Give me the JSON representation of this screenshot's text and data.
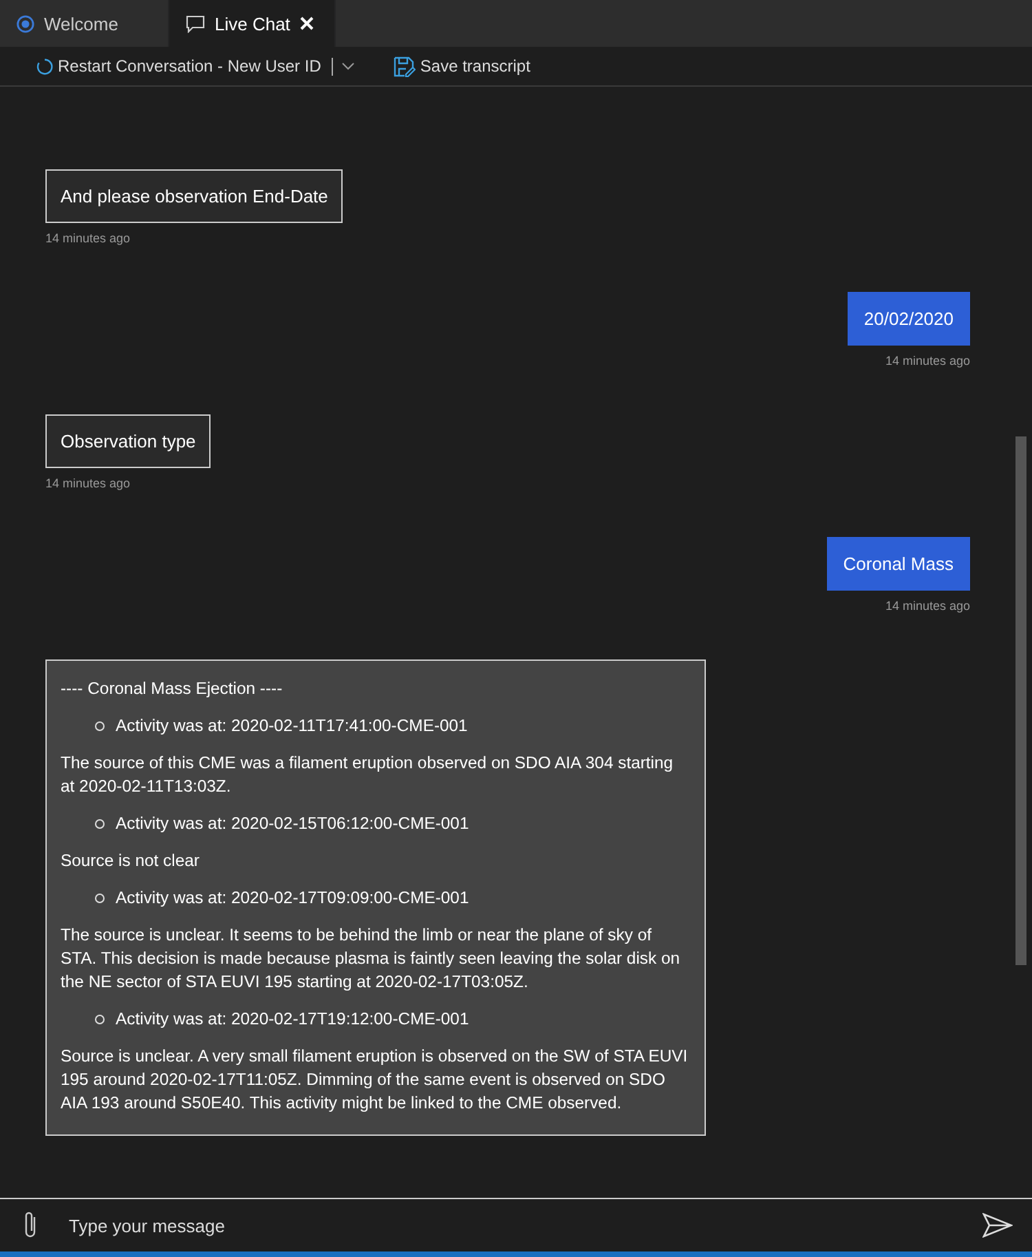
{
  "tabs": [
    {
      "label": "Welcome",
      "selected": false,
      "closable": false
    },
    {
      "label": "Live Chat",
      "selected": true,
      "closable": true
    }
  ],
  "toolbar": {
    "restart": "Restart Conversation - New User ID",
    "save": "Save transcript"
  },
  "messages": [
    {
      "kind": "bot",
      "text": "And please observation End-Date",
      "time": "14 minutes ago"
    },
    {
      "kind": "user",
      "text": "20/02/2020",
      "time": "14 minutes ago"
    },
    {
      "kind": "bot",
      "text": "Observation type",
      "time": "14 minutes ago"
    },
    {
      "kind": "user",
      "text": "Coronal Mass",
      "time": "14 minutes ago"
    },
    {
      "kind": "card",
      "blocks": [
        {
          "kind": "para",
          "text": "---- Coronal Mass Ejection ----"
        },
        {
          "kind": "bullet",
          "text": "Activity was at: 2020-02-11T17:41:00-CME-001"
        },
        {
          "kind": "para",
          "text": "The source of this CME was a filament eruption observed on SDO AIA 304 starting at 2020-02-11T13:03Z."
        },
        {
          "kind": "bullet",
          "text": "Activity was at: 2020-02-15T06:12:00-CME-001"
        },
        {
          "kind": "para",
          "text": "Source is not clear"
        },
        {
          "kind": "bullet",
          "text": "Activity was at: 2020-02-17T09:09:00-CME-001"
        },
        {
          "kind": "para",
          "text": "The source is unclear. It seems to be behind the limb or near the plane of sky of STA. This decision is made because plasma is faintly seen leaving the solar disk on the NE sector of STA EUVI 195 starting at 2020-02-17T03:05Z."
        },
        {
          "kind": "bullet",
          "text": "Activity was at: 2020-02-17T19:12:00-CME-001"
        },
        {
          "kind": "para",
          "text": "Source is unclear. A very small filament eruption is observed on the SW of STA EUVI 195 around 2020-02-17T11:05Z. Dimming of the same event is observed on SDO AIA 193 around S50E40. This activity might be linked to the CME observed."
        }
      ]
    }
  ],
  "input": {
    "placeholder": "Type your message"
  }
}
